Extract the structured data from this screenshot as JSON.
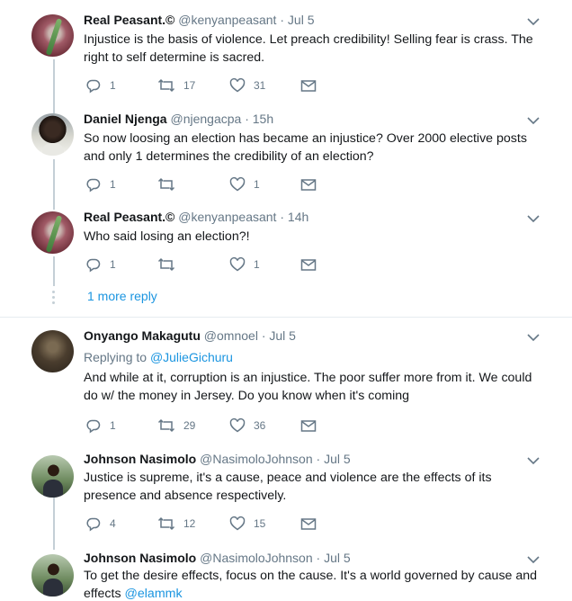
{
  "tweets": [
    {
      "name": "Real Peasant.©",
      "handle": "@kenyanpeasant",
      "dot": "·",
      "time": "Jul 5",
      "text": "Injustice is the basis of violence. Let preach credibility! Selling fear is crass. The right to self determine is sacred.",
      "replies": "1",
      "retweets": "17",
      "likes": "31"
    },
    {
      "name": "Daniel Njenga",
      "handle": "@njengacpa",
      "dot": "·",
      "time": "15h",
      "text": "So now loosing an election has became an injustice? Over 2000 elective posts and only 1 determines the credibility of an election?",
      "replies": "1",
      "retweets": "",
      "likes": "1"
    },
    {
      "name": "Real Peasant.©",
      "handle": "@kenyanpeasant",
      "dot": "·",
      "time": "14h",
      "text": "Who said losing an election?!",
      "replies": "1",
      "retweets": "",
      "likes": "1"
    },
    {
      "name": "Onyango Makagutu",
      "handle": "@omnoel",
      "dot": "·",
      "time": "Jul 5",
      "replying_prefix": "Replying to ",
      "replying_to": "@JulieGichuru",
      "text": "And while at it, corruption is an injustice. The poor suffer more from it. We could do w/ the money in Jersey. Do you know when it's coming",
      "replies": "1",
      "retweets": "29",
      "likes": "36"
    },
    {
      "name": "Johnson Nasimolo",
      "handle": "@NasimoloJohnson",
      "dot": "·",
      "time": "Jul 5",
      "text": "Justice is supreme, it's a cause, peace and violence are the effects of its presence and absence respectively.",
      "replies": "4",
      "retweets": "12",
      "likes": "15"
    },
    {
      "name": "Johnson Nasimolo",
      "handle": "@NasimoloJohnson",
      "dot": "·",
      "time": "Jul 5",
      "text": "To get the desire effects, focus on the cause. It's a world governed by cause and effects ",
      "mention": "@elammk"
    }
  ],
  "more_replies": "1 more reply",
  "colors": {
    "accent": "#1b95e0",
    "secondary_text": "#657786",
    "thread_line": "#c4cfd6"
  }
}
